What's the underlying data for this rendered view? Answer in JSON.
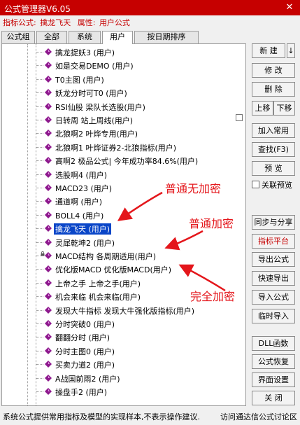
{
  "window": {
    "title": "公式管理器V6.05",
    "close_glyph": "✕"
  },
  "subtitle": {
    "indicator_label": "指标公式:",
    "indicator_name": "擒龙飞天",
    "attr_label": "属性:",
    "attr_value": "用户公式"
  },
  "tabs": [
    {
      "label": "公式组"
    },
    {
      "label": "全部"
    },
    {
      "label": "系统"
    },
    {
      "label": "用户"
    },
    {
      "label": "按日期排序"
    }
  ],
  "tree_items": [
    {
      "label": "擒龙捉妖3 (用户)",
      "icon": "gem-icon"
    },
    {
      "label": "如是交易DEMO (用户)",
      "icon": "gem-icon"
    },
    {
      "label": "T0主图 (用户)",
      "icon": "gem-icon"
    },
    {
      "label": "妖龙分时可T0 (用户)",
      "icon": "gem-icon"
    },
    {
      "label": "RSI仙股 梁队长选股(用户)",
      "icon": "gem-icon"
    },
    {
      "label": "日转周 站上周线(用户)",
      "icon": "gem-icon"
    },
    {
      "label": "北狼啊2 叶烨专用(用户)",
      "icon": "gem-icon"
    },
    {
      "label": "北狼啊1 叶烨证券2-北狼指标(用户)",
      "icon": "gem-icon"
    },
    {
      "label": "高啊2 极品公式| 今年成功率84.6%(用户)",
      "icon": "gem-icon"
    },
    {
      "label": "选股啊4 (用户)",
      "icon": "gem-icon"
    },
    {
      "label": "MACD23 (用户)",
      "icon": "gem-icon"
    },
    {
      "label": "通道啊 (用户)",
      "icon": "gem-icon"
    },
    {
      "label": "BOLL4 (用户)",
      "icon": "gem-icon"
    },
    {
      "label": "擒龙飞天 (用户)",
      "icon": "gem-icon",
      "selected": true
    },
    {
      "label": "灵犀乾坤2 (用户)",
      "icon": "gem-icon"
    },
    {
      "label": "MACD结构 各周期适用(用户)",
      "icon": "gem-icon",
      "locked": true
    },
    {
      "label": "优化版MACD 优化版MACD(用户)",
      "icon": "gem-icon"
    },
    {
      "label": "上帝之手 上帝之手(用户)",
      "icon": "gem-icon"
    },
    {
      "label": "机会来临 机会来临(用户)",
      "icon": "gem-icon"
    },
    {
      "label": "发现大牛指标 发现大牛强化版指标(用户)",
      "icon": "gem-icon"
    },
    {
      "label": "分时突破0 (用户)",
      "icon": "gem-icon"
    },
    {
      "label": "翻翻分时 (用户)",
      "icon": "gem-icon"
    },
    {
      "label": "分时主图0 (用户)",
      "icon": "gem-icon"
    },
    {
      "label": "买卖力道2 (用户)",
      "icon": "gem-icon"
    },
    {
      "label": "A战国前雨2 (用户)",
      "icon": "gem-icon"
    },
    {
      "label": "操盘手2 (用户)",
      "icon": "gem-icon"
    }
  ],
  "buttons": {
    "new": "新 建",
    "new_arrow": "↓",
    "modify": "修 改",
    "delete": "删 除",
    "move_up": "上移",
    "move_down": "下移",
    "add_common": "加入常用",
    "find": "查找(F3)",
    "preview": "预 览",
    "sync_share": "同步与分享",
    "indicator_platform": "指标平台",
    "export": "导出公式",
    "quick_export": "快速导出",
    "import": "导入公式",
    "temp_import": "临时导入",
    "dll": "DLL函数",
    "restore": "公式恢复",
    "ui_settings": "界面设置",
    "close": "关 闭"
  },
  "checkbox": {
    "close_preview_label": "关联预览",
    "checked": false
  },
  "status": {
    "left": "系统公式提供常用指标及模型的实现样本,不表示操作建议.",
    "right": "访问通达信公式讨论区"
  },
  "annotations": {
    "normal_no_encrypt": "普通无加密",
    "normal_encrypt": "普通加密",
    "full_encrypt": "完全加密"
  },
  "colors": {
    "titlebar": "#c60000",
    "selection": "#0a46c8",
    "annotation": "#e4161b",
    "accent_text": "#c60000",
    "gem": "#8e1a8e"
  }
}
